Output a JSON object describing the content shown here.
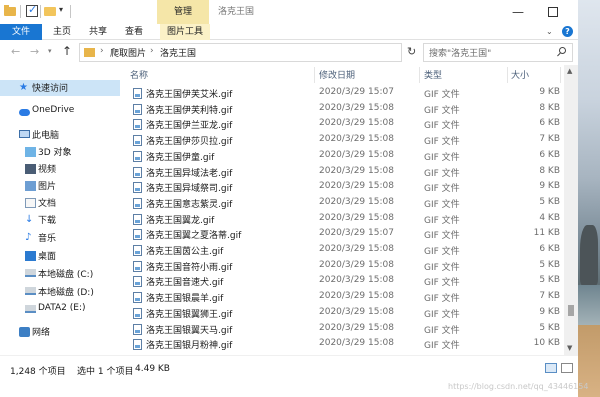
{
  "window": {
    "title": "洛克王国",
    "context_tab": "管理"
  },
  "ribbon": {
    "tabs": [
      "文件",
      "主页",
      "共享",
      "查看",
      "图片工具"
    ]
  },
  "address": {
    "segments": [
      "爬取图片",
      "洛克王国"
    ],
    "search_placeholder": "搜索\"洛克王国\""
  },
  "nav": {
    "items": [
      {
        "label": "快速访问",
        "icon": "star-icon",
        "active": true
      },
      {
        "label": "OneDrive",
        "icon": "cloud-icon"
      },
      {
        "label": "此电脑",
        "icon": "computer-icon"
      },
      {
        "label": "3D 对象",
        "icon": "cube-icon"
      },
      {
        "label": "视频",
        "icon": "video-icon"
      },
      {
        "label": "图片",
        "icon": "picture-icon"
      },
      {
        "label": "文档",
        "icon": "document-icon"
      },
      {
        "label": "下载",
        "icon": "download-icon"
      },
      {
        "label": "音乐",
        "icon": "music-icon"
      },
      {
        "label": "桌面",
        "icon": "desktop-icon"
      },
      {
        "label": "本地磁盘 (C:)",
        "icon": "drive-icon"
      },
      {
        "label": "本地磁盘 (D:)",
        "icon": "drive-icon"
      },
      {
        "label": "DATA2 (E:)",
        "icon": "drive-icon"
      },
      {
        "label": "网络",
        "icon": "network-icon"
      }
    ]
  },
  "columns": {
    "name": "名称",
    "date": "修改日期",
    "type": "类型",
    "size": "大小"
  },
  "files": [
    {
      "name": "洛克王国伊芙艾米.gif",
      "date": "2020/3/29 15:07",
      "type": "GIF 文件",
      "size": "9 KB"
    },
    {
      "name": "洛克王国伊芙利特.gif",
      "date": "2020/3/29 15:08",
      "type": "GIF 文件",
      "size": "8 KB"
    },
    {
      "name": "洛克王国伊兰亚龙.gif",
      "date": "2020/3/29 15:08",
      "type": "GIF 文件",
      "size": "6 KB"
    },
    {
      "name": "洛克王国伊莎贝拉.gif",
      "date": "2020/3/29 15:08",
      "type": "GIF 文件",
      "size": "7 KB"
    },
    {
      "name": "洛克王国伊童.gif",
      "date": "2020/3/29 15:08",
      "type": "GIF 文件",
      "size": "6 KB"
    },
    {
      "name": "洛克王国异域法老.gif",
      "date": "2020/3/29 15:08",
      "type": "GIF 文件",
      "size": "8 KB"
    },
    {
      "name": "洛克王国异域祭司.gif",
      "date": "2020/3/29 15:08",
      "type": "GIF 文件",
      "size": "9 KB"
    },
    {
      "name": "洛克王国意志紫灵.gif",
      "date": "2020/3/29 15:08",
      "type": "GIF 文件",
      "size": "5 KB"
    },
    {
      "name": "洛克王国翼龙.gif",
      "date": "2020/3/29 15:08",
      "type": "GIF 文件",
      "size": "4 KB"
    },
    {
      "name": "洛克王国翼之夏洛蒂.gif",
      "date": "2020/3/29 15:07",
      "type": "GIF 文件",
      "size": "11 KB"
    },
    {
      "name": "洛克王国茵公主.gif",
      "date": "2020/3/29 15:08",
      "type": "GIF 文件",
      "size": "6 KB"
    },
    {
      "name": "洛克王国音符小雨.gif",
      "date": "2020/3/29 15:08",
      "type": "GIF 文件",
      "size": "5 KB"
    },
    {
      "name": "洛克王国音速犬.gif",
      "date": "2020/3/29 15:08",
      "type": "GIF 文件",
      "size": "5 KB"
    },
    {
      "name": "洛克王国银晨羊.gif",
      "date": "2020/3/29 15:08",
      "type": "GIF 文件",
      "size": "7 KB"
    },
    {
      "name": "洛克王国银翼狮王.gif",
      "date": "2020/3/29 15:08",
      "type": "GIF 文件",
      "size": "9 KB"
    },
    {
      "name": "洛克王国银翼天马.gif",
      "date": "2020/3/29 15:08",
      "type": "GIF 文件",
      "size": "5 KB"
    },
    {
      "name": "洛克王国银月粉神.gif",
      "date": "2020/3/29 15:08",
      "type": "GIF 文件",
      "size": "10 KB"
    }
  ],
  "status": {
    "count": "1,248 个项目",
    "selected": "选中 1 个项目",
    "size": "4.49 KB"
  },
  "watermark": "https://blog.csdn.net/qq_43446154"
}
